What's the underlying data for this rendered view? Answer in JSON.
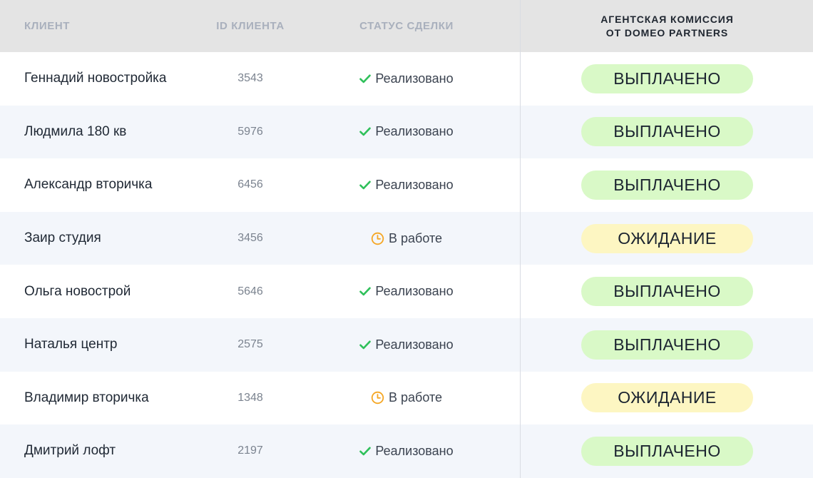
{
  "header": {
    "client": "КЛИЕНТ",
    "client_id": "ID КЛИЕНТА",
    "deal_status": "СТАТУС СДЕЛКИ",
    "commission_line1": "АГЕНТСКАЯ КОМИССИЯ",
    "commission_line2": "ОТ DOMEO PARTNERS"
  },
  "colors": {
    "header_bg": "#e4e4e4",
    "alt_row_bg": "#f3f6fb",
    "check_green": "#2fc05a",
    "clock_orange": "#f5a623",
    "paid_pill": "#d9f9c7",
    "waiting_pill": "#fdf6c2"
  },
  "rows": [
    {
      "client": "Геннадий новостройка",
      "id": "3543",
      "status": "Реализовано",
      "status_icon": "check-icon",
      "commission": "ВЫПЛАЧЕНО"
    },
    {
      "client": "Людмила 180 кв",
      "id": "5976",
      "status": "Реализовано",
      "status_icon": "check-icon",
      "commission": "ВЫПЛАЧЕНО"
    },
    {
      "client": "Александр вторичка",
      "id": "6456",
      "status": "Реализовано",
      "status_icon": "check-icon",
      "commission": "ВЫПЛАЧЕНО"
    },
    {
      "client": "Заир студия",
      "id": "3456",
      "status": "В работе",
      "status_icon": "clock-icon",
      "commission": "ОЖИДАНИЕ"
    },
    {
      "client": "Ольга новострой",
      "id": "5646",
      "status": "Реализовано",
      "status_icon": "check-icon",
      "commission": "ВЫПЛАЧЕНО"
    },
    {
      "client": "Наталья центр",
      "id": "2575",
      "status": "Реализовано",
      "status_icon": "check-icon",
      "commission": "ВЫПЛАЧЕНО"
    },
    {
      "client": "Владимир вторичка",
      "id": "1348",
      "status": "В работе",
      "status_icon": "clock-icon",
      "commission": "ОЖИДАНИЕ"
    },
    {
      "client": "Дмитрий лофт",
      "id": "2197",
      "status": "Реализовано",
      "status_icon": "check-icon",
      "commission": "ВЫПЛАЧЕНО"
    }
  ]
}
